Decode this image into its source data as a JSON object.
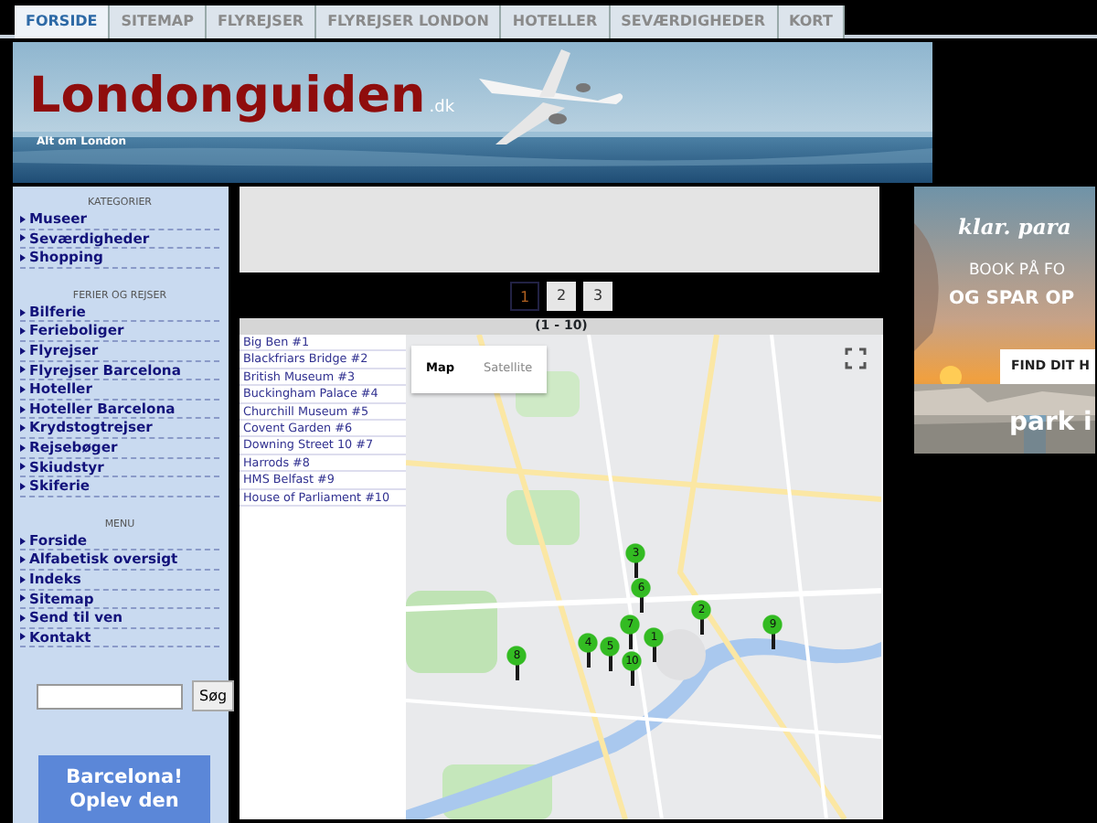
{
  "tabs": [
    {
      "label": "FORSIDE",
      "selected": true
    },
    {
      "label": "SITEMAP",
      "selected": false
    },
    {
      "label": "FLYREJSER",
      "selected": false
    },
    {
      "label": "FLYREJSER LONDON",
      "selected": false
    },
    {
      "label": "HOTELLER",
      "selected": false
    },
    {
      "label": "SEVÆRDIGHEDER",
      "selected": false
    },
    {
      "label": "KORT",
      "selected": false
    }
  ],
  "header": {
    "title": "Londonguiden",
    "suffix": ".dk",
    "tagline": "Alt om London"
  },
  "sidebar": {
    "sections": [
      {
        "heading": "KATEGORIER",
        "items": [
          "Museer",
          "Seværdigheder",
          "Shopping"
        ]
      },
      {
        "heading": "FERIER OG REJSER",
        "items": [
          "Bilferie",
          "Ferieboliger",
          "Flyrejser",
          "Flyrejser Barcelona",
          "Hoteller",
          "Hoteller Barcelona",
          "Krydstogtrejser",
          "Rejsebøger",
          "Skiudstyr",
          "Skiferie"
        ]
      },
      {
        "heading": "MENU",
        "items": [
          "Forside",
          "Alfabetisk oversigt",
          "Indeks",
          "Sitemap",
          "Send til ven",
          "Kontakt"
        ]
      }
    ],
    "search": {
      "button": "Søg"
    },
    "promo": "Barcelona! Oplev den"
  },
  "pagination": [
    {
      "label": "1",
      "selected": true
    },
    {
      "label": "2",
      "selected": false
    },
    {
      "label": "3",
      "selected": false
    }
  ],
  "results": {
    "range": "(1 - 10)",
    "places": [
      "Big Ben #1",
      "Blackfriars Bridge #2",
      "British Museum #3",
      "Buckingham Palace #4",
      "Churchill Museum #5",
      "Covent Garden #6",
      "Downing Street 10 #7",
      "Harrods #8",
      "HMS Belfast #9",
      "House of Parliament #10"
    ],
    "map": {
      "types": [
        {
          "label": "Map",
          "selected": true
        },
        {
          "label": "Satellite",
          "selected": false
        }
      ],
      "markers": [
        {
          "label": "3"
        },
        {
          "label": "6"
        },
        {
          "label": "2"
        },
        {
          "label": "9"
        },
        {
          "label": "7"
        },
        {
          "label": "4"
        },
        {
          "label": "5"
        },
        {
          "label": "1"
        },
        {
          "label": "10"
        },
        {
          "label": "8"
        }
      ]
    }
  },
  "ad": {
    "brand": "klar. para",
    "lines": [
      "BOOK PÅ FO",
      "OG SPAR OP"
    ],
    "button": "FIND DIT H",
    "logo": "park i"
  }
}
